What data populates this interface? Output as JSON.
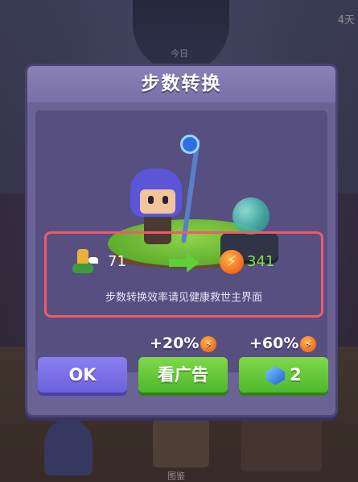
{
  "background": {
    "day_label": "4天",
    "today_label": "今日",
    "bottom_label": "图鉴"
  },
  "dialog": {
    "title": "步数转换",
    "conversion": {
      "steps_value": "71",
      "energy_value": "341",
      "note": "步数转换效率请见健康救世主界面"
    },
    "bonus": [
      {
        "text": "+20%"
      },
      {
        "text": "+60%"
      }
    ],
    "buttons": {
      "ok_label": "OK",
      "ad_label": "看广告",
      "gem_count": "2"
    }
  },
  "colors": {
    "panel": "#6b6296",
    "highlight_border": "#f05a6a",
    "ok_button": "#7a6ee8",
    "green_button": "#62c83a",
    "energy_value": "#7fe04a"
  },
  "icons": {
    "steps": "winged-boot-icon",
    "arrow": "arrow-right-icon",
    "energy": "energy-bolt-icon",
    "gem": "blue-gem-icon"
  }
}
